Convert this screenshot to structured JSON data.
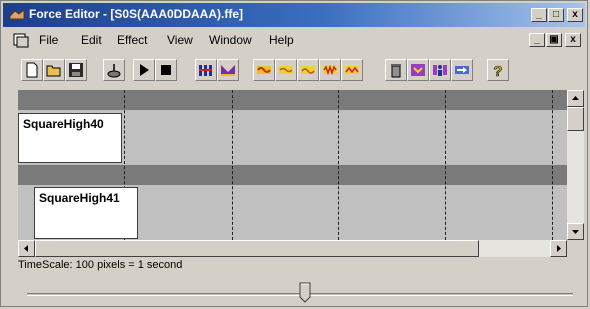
{
  "window": {
    "title": "Force Editor - [S0S(AAA0DDAAA).ffe]",
    "minimize_glyph": "_",
    "restore_glyph": "□",
    "close_glyph": "x",
    "doc_restore_glyph": "▣"
  },
  "menu": {
    "items": [
      "File",
      "Edit",
      "Effect",
      "View",
      "Window",
      "Help"
    ]
  },
  "toolbar": {
    "buttons": [
      "new-file-icon",
      "open-file-icon",
      "save-icon",
      "stick-icon",
      "play-icon",
      "stop-icon",
      "bars-icon",
      "wave-purple-icon",
      "wave-orange-icon",
      "wave-yellow-1-icon",
      "wave-yellow-2-icon",
      "wave-red-icon",
      "wave-yellow-3-icon",
      "trash-icon",
      "magnet-icon",
      "person-icon",
      "arrow-icon",
      "help-icon"
    ]
  },
  "timeline": {
    "effects": [
      "SquareHigh40",
      "SquareHigh41"
    ],
    "lane_separator_color": "#7a7a7a",
    "lane_color": "#c0c0c0"
  },
  "status": {
    "timescale": "TimeScale: 100 pixels = 1 second"
  },
  "slider": {
    "position": 0.5
  }
}
